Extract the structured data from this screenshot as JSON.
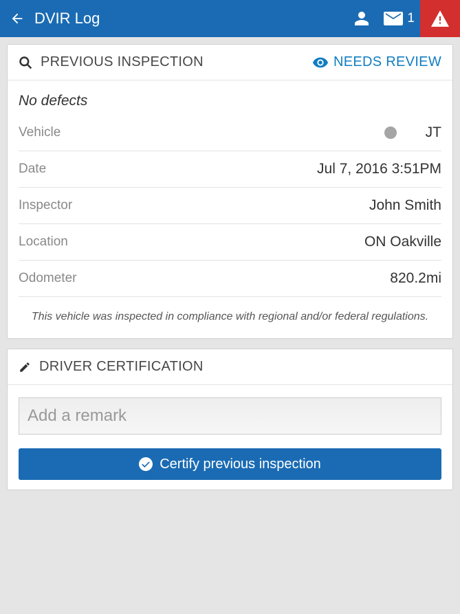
{
  "header": {
    "title": "DVIR Log",
    "messageCount": "1"
  },
  "inspection": {
    "title": "PREVIOUS INSPECTION",
    "reviewLabel": "NEEDS REVIEW",
    "defectsText": "No defects",
    "rows": {
      "vehicle": {
        "label": "Vehicle",
        "value": "JT"
      },
      "date": {
        "label": "Date",
        "value": "Jul 7, 2016 3:51PM"
      },
      "inspector": {
        "label": "Inspector",
        "value": "John Smith"
      },
      "location": {
        "label": "Location",
        "value": "ON Oakville"
      },
      "odometer": {
        "label": "Odometer",
        "value": "820.2mi"
      }
    },
    "complianceText": "This vehicle was inspected in compliance with regional and/or federal regulations."
  },
  "certification": {
    "title": "DRIVER CERTIFICATION",
    "remarkPlaceholder": "Add a remark",
    "certifyButton": "Certify previous inspection"
  }
}
